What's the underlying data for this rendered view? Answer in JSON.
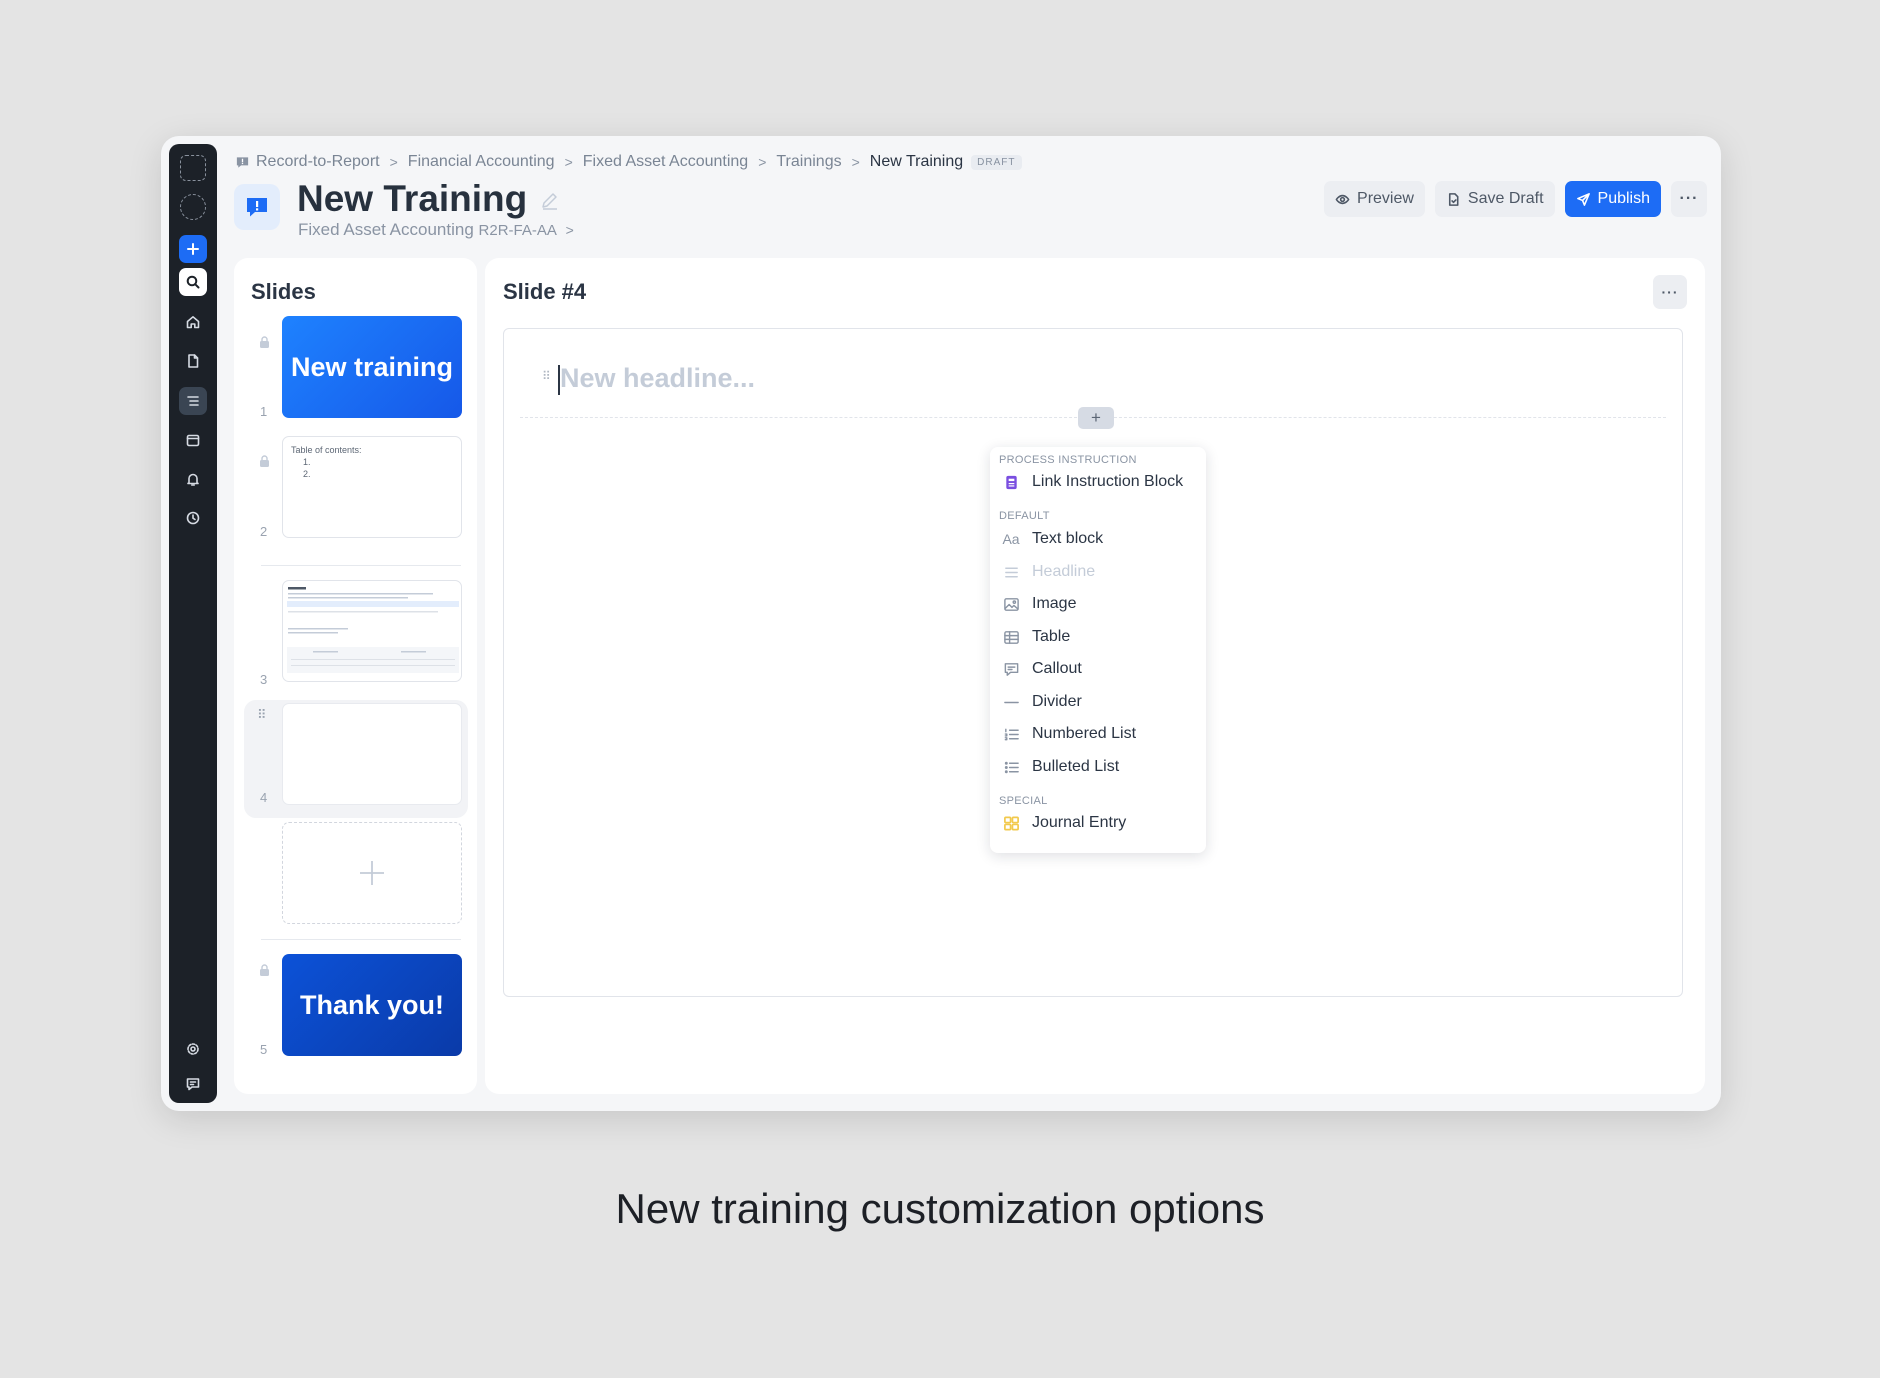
{
  "breadcrumb": [
    "Record-to-Report",
    "Financial Accounting",
    "Fixed Asset Accounting",
    "Trainings",
    "New Training"
  ],
  "status_badge": "DRAFT",
  "page_title": "New Training",
  "subtitle": {
    "name": "Fixed Asset Accounting",
    "code": "R2R-FA-AA"
  },
  "toolbar": {
    "preview_label": "Preview",
    "save_label": "Save Draft",
    "publish_label": "Publish",
    "more_label": "···"
  },
  "slides_panel": {
    "title": "Slides",
    "items": [
      {
        "number": "1",
        "label": "New training"
      },
      {
        "number": "2",
        "toc_title": "Table of contents:",
        "toc_items": [
          "1.",
          "2."
        ]
      },
      {
        "number": "3"
      },
      {
        "number": "4"
      },
      {
        "number": "5",
        "label": "Thank you!"
      }
    ],
    "add_label": "+"
  },
  "editor": {
    "title": "Slide #4",
    "more_label": "···",
    "headline_placeholder": "New headline...",
    "add_block_label": "+"
  },
  "block_menu": {
    "sections": [
      {
        "header": "PROCESS INSTRUCTION",
        "items": [
          {
            "label": "Link Instruction Block",
            "icon": "instruction-icon"
          }
        ]
      },
      {
        "header": "DEFAULT",
        "items": [
          {
            "label": "Text block",
            "icon": "text-icon"
          },
          {
            "label": "Headline",
            "icon": "headline-icon",
            "disabled": true
          },
          {
            "label": "Image",
            "icon": "image-icon"
          },
          {
            "label": "Table",
            "icon": "table-icon"
          },
          {
            "label": "Callout",
            "icon": "callout-icon"
          },
          {
            "label": "Divider",
            "icon": "divider-icon"
          },
          {
            "label": "Numbered List",
            "icon": "numbered-list-icon"
          },
          {
            "label": "Bulleted List",
            "icon": "bulleted-list-icon"
          }
        ]
      },
      {
        "header": "SPECIAL",
        "items": [
          {
            "label": "Journal Entry",
            "icon": "journal-entry-icon"
          }
        ]
      }
    ]
  },
  "colors": {
    "accent": "#1d6cf5",
    "rail": "#1c2128",
    "instruction_icon": "#7a4ee0",
    "journal_icon": "#f2c94c"
  },
  "caption": "New training customization options"
}
